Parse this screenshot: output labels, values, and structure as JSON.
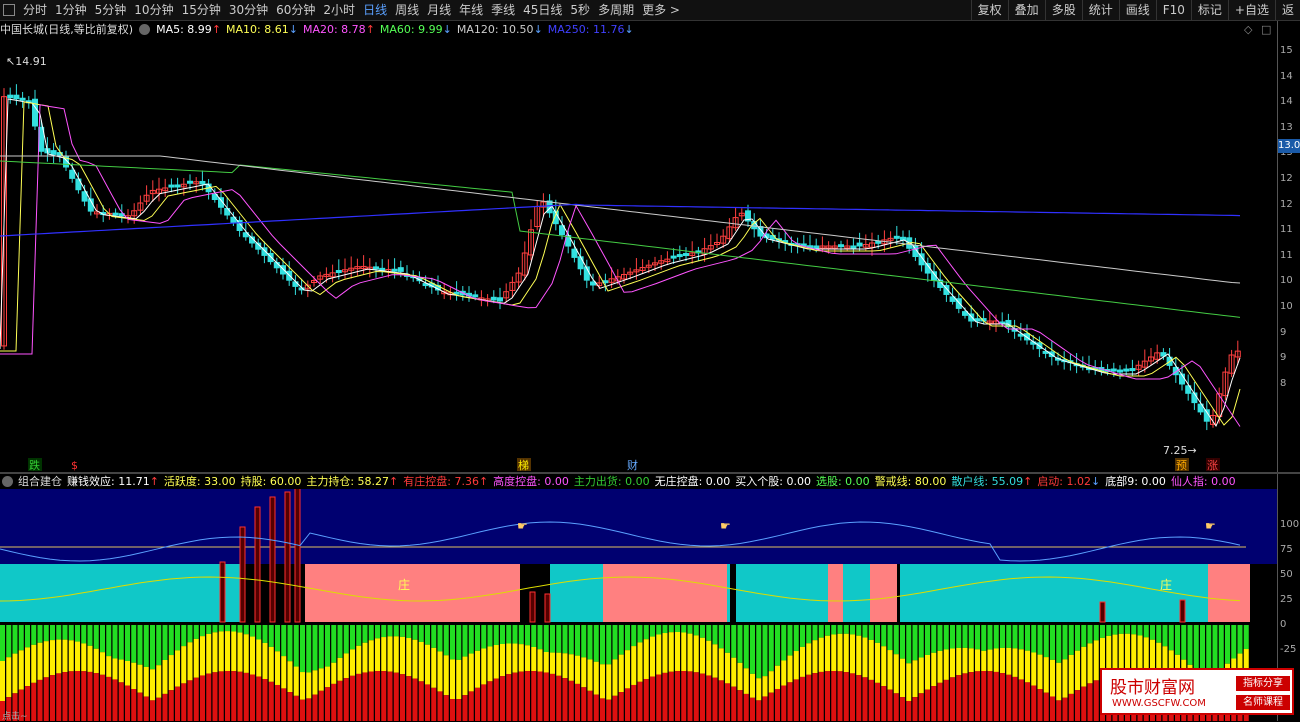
{
  "toolbar": {
    "periods": [
      "分时",
      "1分钟",
      "5分钟",
      "10分钟",
      "15分钟",
      "30分钟",
      "60分钟",
      "2小时",
      "日线",
      "周线",
      "月线",
      "年线",
      "季线",
      "45日线",
      "5秒",
      "多周期",
      "更多"
    ],
    "active": "日线",
    "right": [
      "复权",
      "叠加",
      "多股",
      "统计",
      "画线",
      "F10",
      "标记",
      "+自选",
      "返"
    ]
  },
  "stock": {
    "title": "中国长城(日线,等比前复权)",
    "ma": [
      {
        "label": "MA5: 8.99",
        "arrow": "↑",
        "color": "#ffffff",
        "arrow_color": "#ff3b3b"
      },
      {
        "label": "MA10: 8.61",
        "arrow": "↓",
        "color": "#ffff55",
        "arrow_color": "#5aa0ff"
      },
      {
        "label": "MA20: 8.78",
        "arrow": "↑",
        "color": "#ff55ff",
        "arrow_color": "#ff3b3b"
      },
      {
        "label": "MA60: 9.99",
        "arrow": "↓",
        "color": "#55ff55",
        "arrow_color": "#5aa0ff"
      },
      {
        "label": "MA120: 10.50",
        "arrow": "↓",
        "color": "#cccccc",
        "arrow_color": "#5aa0ff"
      },
      {
        "label": "MA250: 11.76",
        "arrow": "↓",
        "color": "#4040ff",
        "arrow_color": "#5aa0ff"
      }
    ],
    "high_label": "14.91",
    "low_label": "7.25",
    "price_tag": "13.0",
    "price_ticks": [
      "15",
      "14",
      "14",
      "13",
      "13",
      "12",
      "12",
      "11",
      "11",
      "10",
      "10",
      "9",
      "9",
      "8"
    ],
    "markers": [
      {
        "text": "跌",
        "color": "#33cc33",
        "bg": "#003300"
      },
      {
        "text": "$",
        "color": "#ff3333",
        "bg": "#000000"
      },
      {
        "text": "梯",
        "color": "#ffee00",
        "bg": "#553300"
      },
      {
        "text": "财",
        "color": "#66aaff",
        "bg": "#000000"
      },
      {
        "text": "预",
        "color": "#ffaa00",
        "bg": "#553300"
      },
      {
        "text": "涨",
        "color": "#ff4444",
        "bg": "#330000"
      }
    ]
  },
  "indicator": {
    "name": "组合建仓",
    "items": [
      {
        "label": "赚钱效应: 11.71",
        "arrow": "↑",
        "color": "#ffffff",
        "arrow_color": "#ff3b3b"
      },
      {
        "label": "活跃度: 33.00",
        "arrow": "",
        "color": "#ffff55",
        "arrow_color": ""
      },
      {
        "label": "持股: 60.00",
        "arrow": "",
        "color": "#ffff55",
        "arrow_color": ""
      },
      {
        "label": "主力持仓: 58.27",
        "arrow": "↑",
        "color": "#ffff55",
        "arrow_color": "#ff3b3b"
      },
      {
        "label": "有庄控盘: 7.36",
        "arrow": "↑",
        "color": "#ff3b3b",
        "arrow_color": "#ff3b3b"
      },
      {
        "label": "高度控盘: 0.00",
        "arrow": "",
        "color": "#ff55ff",
        "arrow_color": ""
      },
      {
        "label": "主力出货: 0.00",
        "arrow": "",
        "color": "#33cc33",
        "arrow_color": ""
      },
      {
        "label": "无庄控盘: 0.00",
        "arrow": "",
        "color": "#ffffff",
        "arrow_color": ""
      },
      {
        "label": "买入个股: 0.00",
        "arrow": "",
        "color": "#ffffff",
        "arrow_color": ""
      },
      {
        "label": "选股: 0.00",
        "arrow": "",
        "color": "#55ff55",
        "arrow_color": ""
      },
      {
        "label": "警戒线: 80.00",
        "arrow": "",
        "color": "#ffff55",
        "arrow_color": ""
      },
      {
        "label": "散户线: 55.09",
        "arrow": "↑",
        "color": "#33dddd",
        "arrow_color": "#ff3b3b"
      },
      {
        "label": "启动: 1.02",
        "arrow": "↓",
        "color": "#ff3b3b",
        "arrow_color": "#5aa0ff"
      },
      {
        "label": "底部9: 0.00",
        "arrow": "",
        "color": "#ffffff",
        "arrow_color": ""
      },
      {
        "label": "仙人指: 0.00",
        "arrow": "",
        "color": "#ff55ff",
        "arrow_color": ""
      }
    ],
    "zhuang_label": "庄",
    "ticks": [
      "100",
      "75",
      "50",
      "25",
      "0",
      "-25"
    ]
  },
  "watermark": {
    "title": "股市财富网",
    "url": "WWW.GSCFW.COM",
    "tag1": "指标分享",
    "tag2": "名师课程"
  },
  "footer": "点击~"
}
